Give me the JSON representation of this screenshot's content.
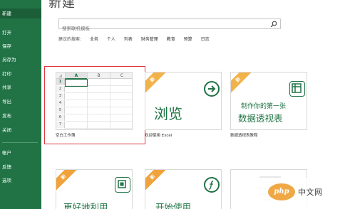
{
  "sidebar": {
    "items": [
      {
        "label": "新建",
        "active": true
      },
      {
        "label": "打开"
      },
      {
        "label": "保存"
      },
      {
        "label": "另存为"
      },
      {
        "label": "打印"
      },
      {
        "label": "共享"
      },
      {
        "label": "导出"
      },
      {
        "label": "发布"
      },
      {
        "label": "关闭"
      },
      {
        "label": "帐户"
      },
      {
        "label": "反馈"
      },
      {
        "label": "选项"
      }
    ]
  },
  "header": {
    "title": "新建"
  },
  "search": {
    "placeholder": "搜索联机模板"
  },
  "suggested": {
    "label": "建议的搜索:",
    "links": [
      "业务",
      "个人",
      "列表",
      "财务管理",
      "教育",
      "预算",
      "日志"
    ]
  },
  "templates": {
    "blank": {
      "caption": "空白工作簿",
      "columns": [
        "A",
        "B",
        "C"
      ],
      "rows": [
        "1",
        "2",
        "3",
        "4",
        "5",
        "6",
        "7"
      ]
    },
    "tour": {
      "badge": "新",
      "big": "浏览",
      "caption": "欢迎使用 Excel"
    },
    "pivot": {
      "badge": "新",
      "line1": "制作你的第一张",
      "line2": "数据透视表",
      "caption": "数据透视表教程"
    },
    "more": {
      "badge": "新",
      "big": "更好地利用"
    },
    "start": {
      "badge": "新",
      "big": "开始使用"
    }
  },
  "watermark": {
    "logo": "php",
    "text": "中文网"
  },
  "colors": {
    "accent": "#217346",
    "selected": "#e0393e",
    "ribbon": "#f2b24a"
  }
}
